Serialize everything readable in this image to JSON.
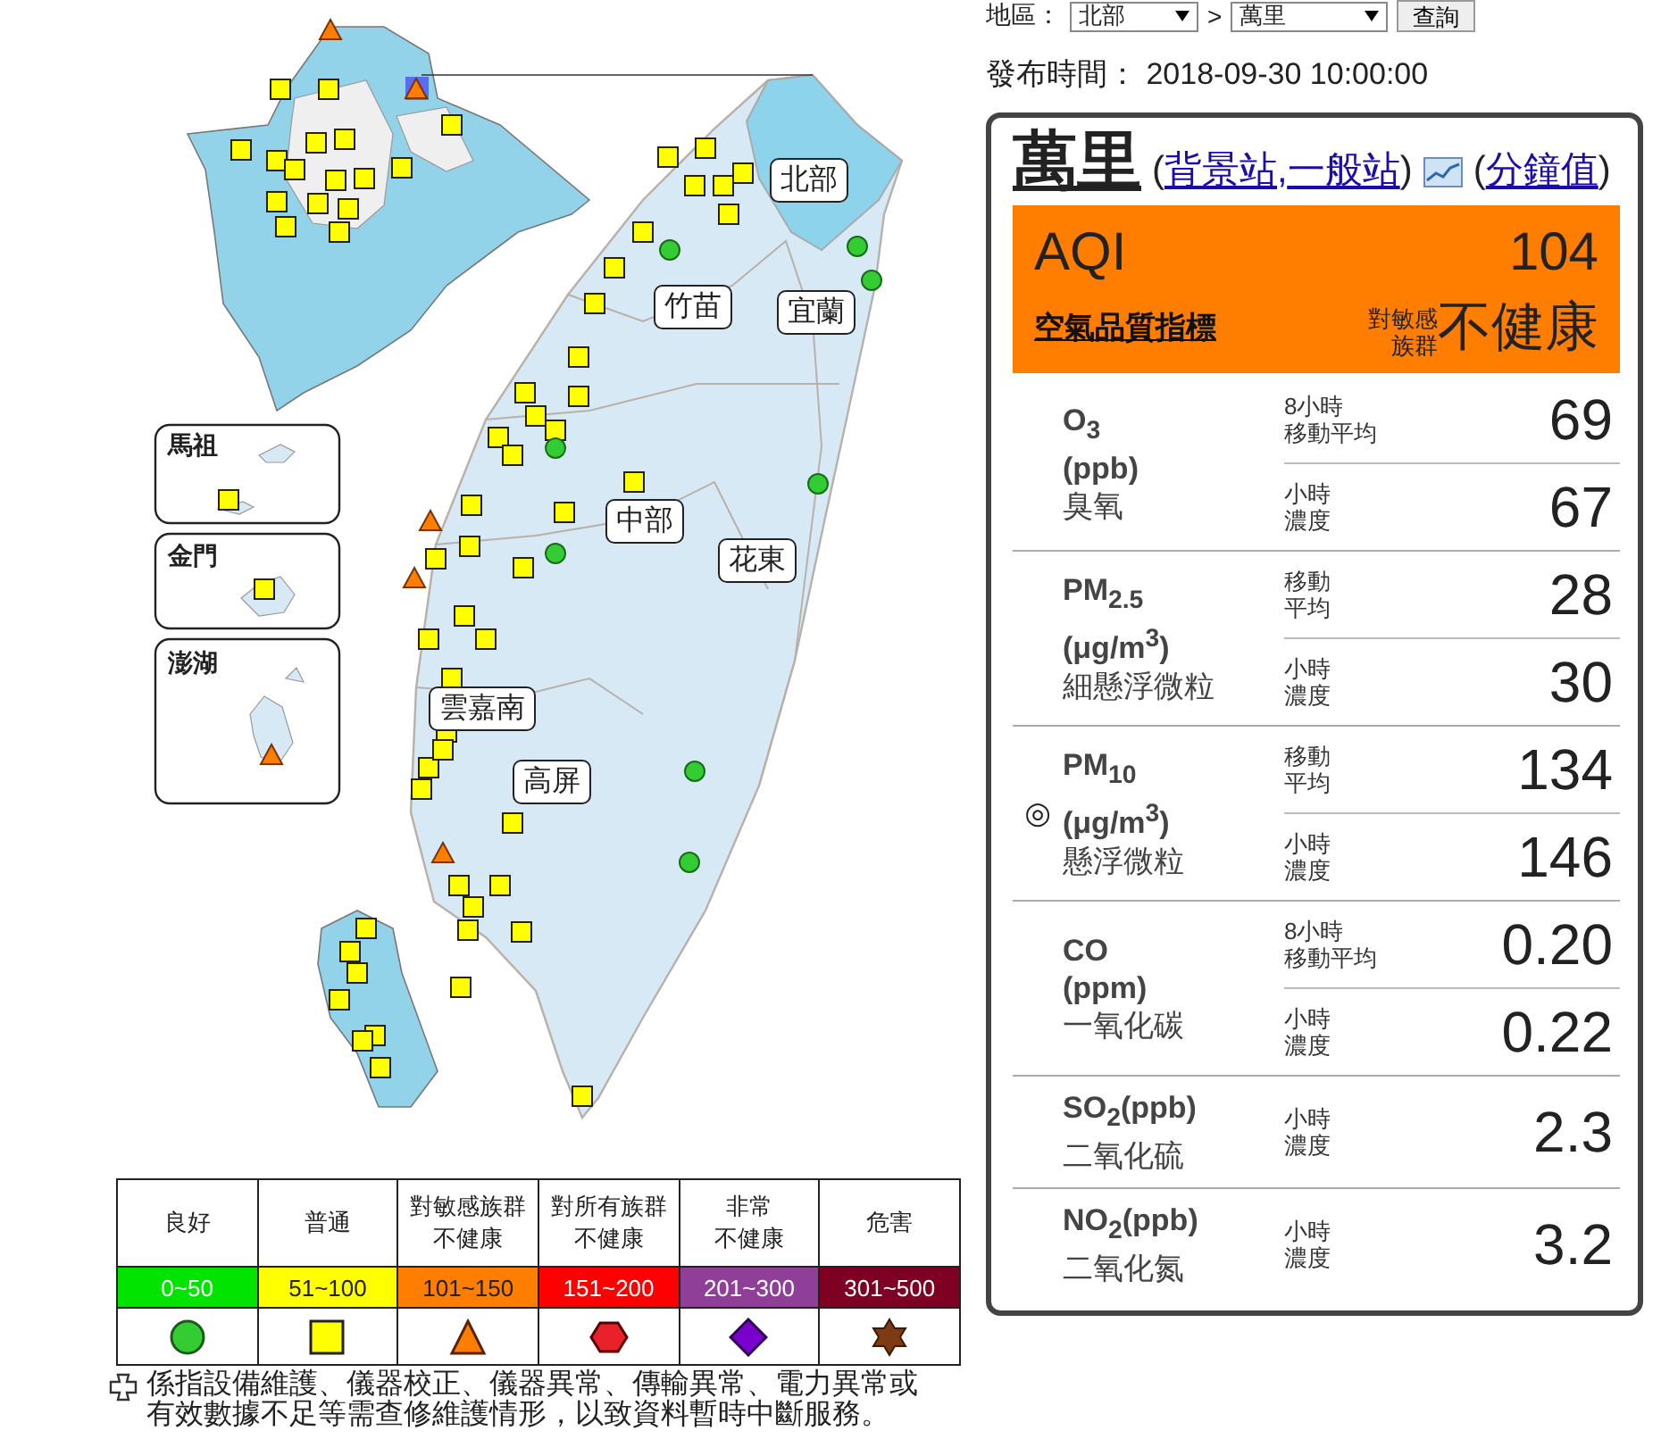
{
  "filter": {
    "label": "地區：",
    "region": "北部",
    "separator": ">",
    "station": "萬里",
    "button": "查詢"
  },
  "publish_time": "發布時間： 2018-09-30 10:00:00",
  "map": {
    "region_labels": [
      "北部",
      "竹苗",
      "宜蘭",
      "中部",
      "花東",
      "雲嘉南",
      "高屏"
    ],
    "insets": [
      "馬祖",
      "金門",
      "澎湖"
    ]
  },
  "legend": [
    {
      "label": [
        "良好"
      ],
      "range": "0~50",
      "color": "#00e400",
      "kind": "circle"
    },
    {
      "label": [
        "普通"
      ],
      "range": "51~100",
      "color": "#ffff00",
      "kind": "square"
    },
    {
      "label": [
        "對敏感族群",
        "不健康"
      ],
      "range": "101~150",
      "color": "#ff7e00",
      "kind": "triangle"
    },
    {
      "label": [
        "對所有族群",
        "不健康"
      ],
      "range": "151~200",
      "color": "#ff0000",
      "kind": "hexagon"
    },
    {
      "label": [
        "非常",
        "不健康"
      ],
      "range": "201~300",
      "color": "#8f3f97",
      "kind": "diamond"
    },
    {
      "label": [
        "危害"
      ],
      "range": "301~500",
      "color": "#7e0023",
      "kind": "star"
    }
  ],
  "note": "係指設備維護、儀器校正、儀器異常、傳輸異常、電力異常或有效數據不足等需查修維護情形，以致資料暫時中斷服務。",
  "station": {
    "name": "萬里",
    "type_before": "(",
    "type_links": [
      "背景站",
      "一般站"
    ],
    "type_separator": ",",
    "type_after": ")",
    "minute_before": "(",
    "minute_link": "分鐘值",
    "minute_after": ")"
  },
  "aqi": {
    "label": "AQI",
    "value": "104",
    "link": "空氣品質指標",
    "group": [
      "對敏感",
      "族群"
    ],
    "status": "不健康",
    "color": "#ff7e00"
  },
  "pollutants": [
    {
      "name": "O$_{3}$",
      "unit": "(ppb)",
      "zh": "臭氧",
      "primary": false,
      "readings": [
        {
          "label": [
            "8小時",
            "移動平均"
          ],
          "value": "69"
        },
        {
          "label": [
            "小時",
            "濃度"
          ],
          "value": "67"
        }
      ]
    },
    {
      "name": "PM$_{2.5}$",
      "unit": "(μg/m$^{3}$)",
      "zh": "細懸浮微粒",
      "primary": false,
      "readings": [
        {
          "label": [
            "移動",
            "平均"
          ],
          "value": "28"
        },
        {
          "label": [
            "小時",
            "濃度"
          ],
          "value": "30"
        }
      ]
    },
    {
      "name": "PM$_{10}$",
      "unit": "(μg/m$^{3}$)",
      "zh": "懸浮微粒",
      "primary": true,
      "readings": [
        {
          "label": [
            "移動",
            "平均"
          ],
          "value": "134"
        },
        {
          "label": [
            "小時",
            "濃度"
          ],
          "value": "146"
        }
      ]
    },
    {
      "name": "CO",
      "unit": "(ppm)",
      "zh": "一氧化碳",
      "primary": false,
      "readings": [
        {
          "label": [
            "8小時",
            "移動平均"
          ],
          "value": "0.20"
        },
        {
          "label": [
            "小時",
            "濃度"
          ],
          "value": "0.22"
        }
      ]
    },
    {
      "name": "SO$_{2}$(ppb)",
      "zh": "二氧化硫",
      "primary": false,
      "readings": [
        {
          "label": [
            "小時",
            "濃度"
          ],
          "value": "2.3"
        }
      ]
    },
    {
      "name": "NO$_{2}$(ppb)",
      "zh": "二氧化氮",
      "primary": false,
      "readings": [
        {
          "label": [
            "小時",
            "濃度"
          ],
          "value": "3.2"
        }
      ]
    }
  ],
  "primary_mark": "◎"
}
